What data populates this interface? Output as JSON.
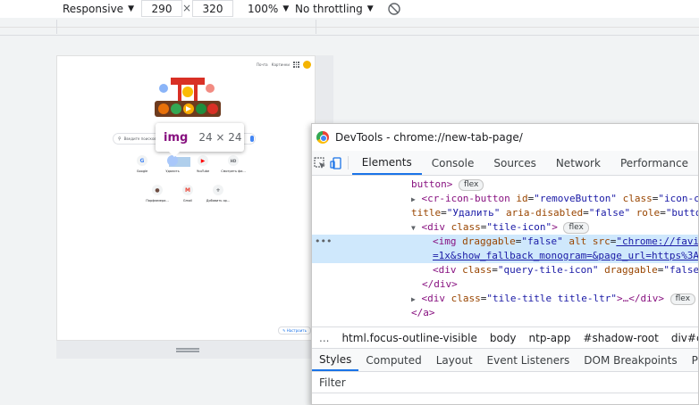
{
  "device_toolbar": {
    "dimension_preset": "Responsive",
    "width": "290",
    "height": "320",
    "times": "×",
    "zoom": "100%",
    "throttling": "No throttling",
    "caret": "▼"
  },
  "emulated_page": {
    "top_links": [
      "Почта",
      "Картинки"
    ],
    "search_placeholder": "Введите поисковый запрос или URL",
    "tiles_row1": [
      {
        "icon": "G",
        "title": "Google",
        "color": "#4285f4"
      },
      {
        "icon": "",
        "title": "Удалить",
        "color": "#5f6368"
      },
      {
        "icon": "▶",
        "title": "YouTube",
        "color": "#ff0000"
      },
      {
        "icon": "HD",
        "title": "Смотреть фи...",
        "color": "#5f6368"
      }
    ],
    "tiles_row2": [
      {
        "icon": "●",
        "title": "Парфюмери...",
        "color": "#6d4c41"
      },
      {
        "icon": "M",
        "title": "Gmail",
        "color": "#ea4335"
      },
      {
        "icon": "+",
        "title": "Добавить яр...",
        "color": "#5f6368"
      }
    ],
    "customize_label": "✎ Настроить"
  },
  "tooltip": {
    "tag": "img",
    "size": "24 × 24"
  },
  "devtools": {
    "title": "DevTools - chrome://new-tab-page/",
    "tabs": [
      "Elements",
      "Console",
      "Sources",
      "Network",
      "Performance"
    ],
    "active_tab": "Elements",
    "flex_badge": "flex",
    "code": {
      "l1_text": "button>",
      "l2_tag_open": "<cr-icon-button",
      "l2_a1": "id",
      "l2_v1": "\"removeButton\"",
      "l2_a2": "class",
      "l2_v2": "\"icon-c",
      "l3_a1": "title",
      "l3_v1": "\"Удалить\"",
      "l3_a2": "aria-disabled",
      "l3_v2": "\"false\"",
      "l3_a3": "role",
      "l3_v3": "\"butto",
      "l4_tag": "<div",
      "l4_a1": "class",
      "l4_v1": "\"tile-icon\"",
      "l4_close": ">",
      "l5_tag": "<img",
      "l5_a1": "draggable",
      "l5_v1": "\"false\"",
      "l5_a2": "alt",
      "l5_a3": "src",
      "l5_v3": "\"chrome://favi",
      "l6_link": "=1x&show_fallback_monogram=&page_url=https%3A%",
      "l7_tag": "<div",
      "l7_a1": "class",
      "l7_v1": "\"query-tile-icon\"",
      "l7_a2": "draggable",
      "l7_v2": "\"false\"",
      "l8_text": "</div>",
      "l9_tag": "<div",
      "l9_a1": "class",
      "l9_v1": "\"tile-title title-ltr\"",
      "l9_rest": ">…</div>",
      "l10_text": "</a>"
    },
    "dots": "•••",
    "breadcrumbs": [
      "...",
      "html.focus-outline-visible",
      "body",
      "ntp-app",
      "#shadow-root",
      "div#content"
    ],
    "styles_tabs": [
      "Styles",
      "Computed",
      "Layout",
      "Event Listeners",
      "DOM Breakpoints",
      "Prope"
    ],
    "active_styles_tab": "Styles",
    "filter_placeholder": "Filter"
  }
}
